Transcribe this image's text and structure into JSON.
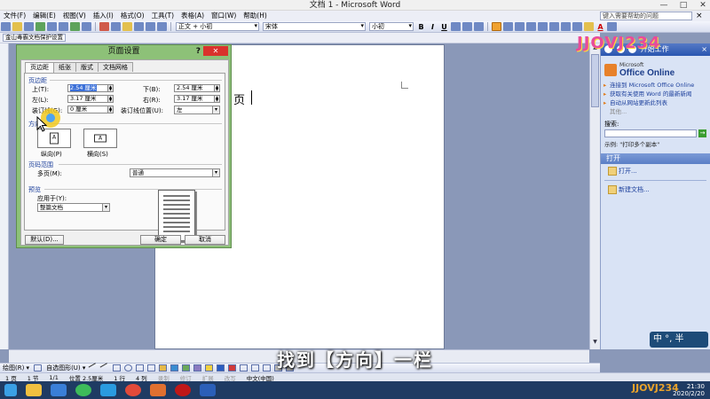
{
  "window": {
    "title": "文档 1 - Microsoft Word",
    "minimize": "—",
    "maximize": "□",
    "close": "✕"
  },
  "menubar": {
    "items": [
      "文件(F)",
      "编辑(E)",
      "视图(V)",
      "插入(I)",
      "格式(O)",
      "工具(T)",
      "表格(A)",
      "窗口(W)",
      "帮助(H)"
    ],
    "help_placeholder": "键入需要帮助的问题",
    "help_close": "×"
  },
  "format_toolbar": {
    "style": "正文 + 小初",
    "font": "宋体",
    "size": "小初",
    "bold": "B",
    "italic": "I",
    "underline": "U",
    "font_color": "A"
  },
  "protect_toolbar": {
    "label": "金山毒霸文档保护设置"
  },
  "document": {
    "text": "页"
  },
  "dialog": {
    "title": "页面设置",
    "help": "?",
    "close": "✕",
    "tabs": [
      "页边距",
      "纸张",
      "版式",
      "文档网格"
    ],
    "margins_group": "页边距",
    "top_label": "上(T):",
    "top_value": "2.54 厘米",
    "bottom_label": "下(B):",
    "bottom_value": "2.54 厘米",
    "left_label": "左(L):",
    "left_value": "3.17 厘米",
    "right_label": "右(R):",
    "right_value": "3.17 厘米",
    "gutter_label": "装订线(G):",
    "gutter_value": "0 厘米",
    "gutter_pos_label": "装订线位置(U):",
    "gutter_pos_value": "左",
    "orientation_group": "方向",
    "portrait_label": "纵向(P)",
    "landscape_label": "横向(S)",
    "portrait_glyph": "A",
    "landscape_glyph": "A",
    "pages_group": "页码范围",
    "multiple_pages_label": "多页(M):",
    "multiple_pages_value": "普通",
    "preview_group": "预览",
    "apply_to_label": "应用于(Y):",
    "apply_to_value": "整篇文档",
    "default_button": "默认(D)...",
    "ok_button": "确定",
    "cancel_button": "取消"
  },
  "taskpane": {
    "title": "开始工作",
    "close": "×",
    "ms_label": "Microsoft",
    "office_online": "Office Online",
    "links": [
      "连接到 Microsoft Office Online",
      "获取有关使用 Word 的最新新闻",
      "自动从网站更新此列表"
    ],
    "more": "其他...",
    "search_label": "搜索:",
    "go": "→",
    "example": "示例: \"打印多个副本\"",
    "open_section": "打开",
    "open_items": [
      "打开...",
      "新建文档..."
    ]
  },
  "drawbar": {
    "draw": "绘图(R) ▾",
    "autoshapes": "自选图形(U) ▾"
  },
  "statusbar": {
    "page": "1 页",
    "section": "1 节",
    "pages": "1/1",
    "position": "位置 2.5厘米",
    "line": "1 行",
    "column": "4 列",
    "rec": "录制",
    "trk": "修订",
    "ext": "扩展",
    "ovr": "改写",
    "lang": "中文(中国)"
  },
  "ime": {
    "text": "中 °, 半"
  },
  "clock": {
    "time": "21:30",
    "date": "2020/2/20"
  },
  "subtitle": "找到【方向】一栏",
  "watermark": "JJOVJ234",
  "watermark_small": "JJOVJ234",
  "colors": {
    "dialog_frame": "#8dc178",
    "selection": "#3a6fd8",
    "taskpane_header": "#2a56b0",
    "highlight_ring": "#f0c81e"
  }
}
